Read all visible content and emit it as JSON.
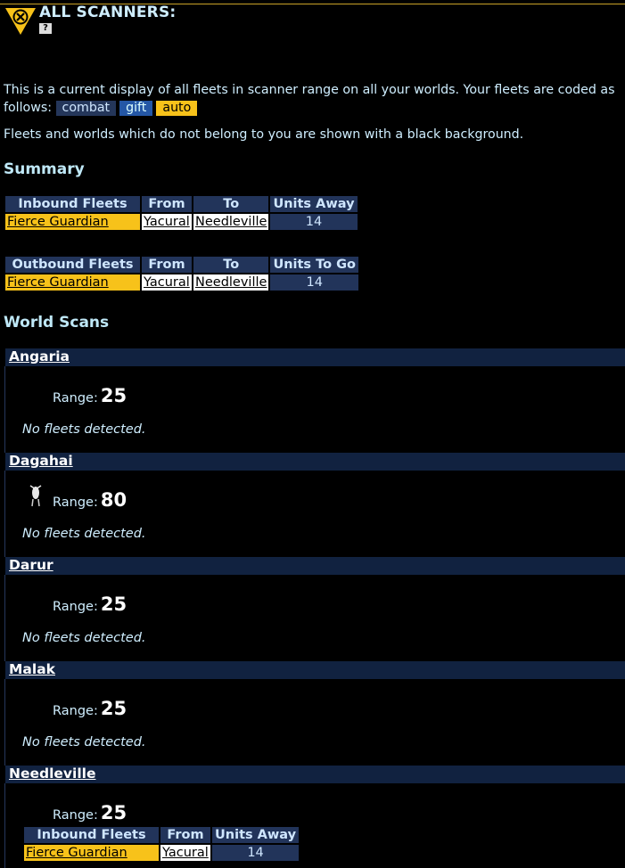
{
  "header": {
    "title": "ALL SCANNERS:",
    "help_label": "?"
  },
  "intro": {
    "text": "This is a current display of all fleets in scanner range on all your worlds. Your fleets are coded as follows:",
    "tags": [
      "combat",
      "gift",
      "auto"
    ],
    "note": "Fleets and worlds which do not belong to you are shown with a black background."
  },
  "summary": {
    "heading": "Summary",
    "inbound": {
      "headers": [
        "Inbound Fleets",
        "From",
        "To",
        "Units Away"
      ],
      "rows": [
        {
          "fleet": "Fierce Guardian",
          "from": "Yacural",
          "to": "Needleville",
          "units": "14"
        }
      ]
    },
    "outbound": {
      "headers": [
        "Outbound Fleets",
        "From",
        "To",
        "Units To Go"
      ],
      "rows": [
        {
          "fleet": "Fierce Guardian",
          "from": "Yacural",
          "to": "Needleville",
          "units": "14"
        }
      ]
    }
  },
  "world_scans": {
    "heading": "World Scans",
    "range_label": "Range:",
    "worlds": [
      {
        "name": "Angaria",
        "range": "25",
        "status": "No fleets detected."
      },
      {
        "name": "Dagahai",
        "range": "80",
        "status": "No fleets detected."
      },
      {
        "name": "Darur",
        "range": "25",
        "status": "No fleets detected."
      },
      {
        "name": "Malak",
        "range": "25",
        "status": "No fleets detected."
      },
      {
        "name": "Needleville",
        "range": "25"
      }
    ],
    "needleville_inbound": {
      "headers": [
        "Inbound Fleets",
        "From",
        "Units Away"
      ],
      "rows": [
        {
          "fleet": "Fierce Guardian",
          "from": "Yacural",
          "units": "14"
        }
      ]
    }
  },
  "colors": {
    "auto": "#f7c21a",
    "gift": "#2457a6",
    "combat": "#24365a",
    "header_bg": "#22345a"
  }
}
